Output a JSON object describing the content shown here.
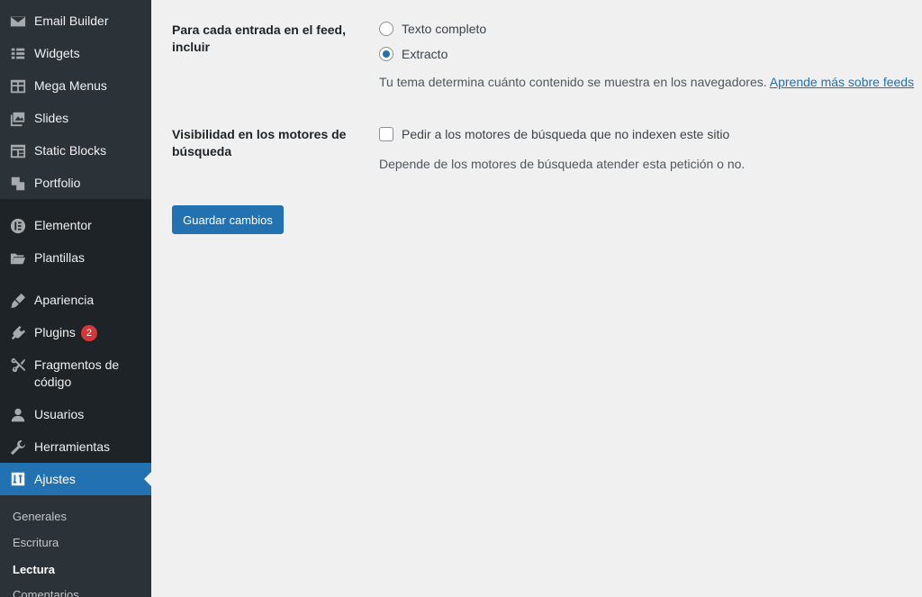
{
  "sidebar": {
    "items": [
      {
        "label": "Email Builder",
        "icon": "email-icon"
      },
      {
        "label": "Widgets",
        "icon": "widgets-icon"
      },
      {
        "label": "Mega Menus",
        "icon": "mega-menus-icon"
      },
      {
        "label": "Slides",
        "icon": "slides-icon"
      },
      {
        "label": "Static Blocks",
        "icon": "static-blocks-icon"
      },
      {
        "label": "Portfolio",
        "icon": "portfolio-icon"
      },
      {
        "label": "Elementor",
        "icon": "elementor-icon"
      },
      {
        "label": "Plantillas",
        "icon": "folder-icon"
      },
      {
        "label": "Apariencia",
        "icon": "paintbrush-icon"
      },
      {
        "label": "Plugins",
        "icon": "plugin-icon",
        "badge": "2"
      },
      {
        "label": "Fragmentos de código",
        "icon": "scissors-icon"
      },
      {
        "label": "Usuarios",
        "icon": "user-icon"
      },
      {
        "label": "Herramientas",
        "icon": "wrench-icon"
      },
      {
        "label": "Ajustes",
        "icon": "settings-icon",
        "active": true
      }
    ],
    "submenu": [
      "Generales",
      "Escritura",
      "Lectura",
      "Comentarios"
    ],
    "current_submenu": "Lectura"
  },
  "form": {
    "feed_label": "Para cada entrada en el feed, incluir",
    "feed_options": [
      {
        "label": "Texto completo",
        "checked": false
      },
      {
        "label": "Extracto",
        "checked": true
      }
    ],
    "feed_desc": "Tu tema determina cuánto contenido se muestra en los navegadores.",
    "feed_link": "Aprende más sobre feeds",
    "visibility_label": "Visibilidad en los motores de búsqueda",
    "visibility_checkbox": "Pedir a los motores de búsqueda que no indexen este sitio",
    "visibility_desc": "Depende de los motores de búsqueda atender esta petición o no.",
    "save_label": "Guardar cambios"
  },
  "colors": {
    "sidebar_bg": "#1d2327",
    "accent": "#2271b1",
    "badge": "#d63638",
    "content_bg": "#f0f0f1"
  }
}
